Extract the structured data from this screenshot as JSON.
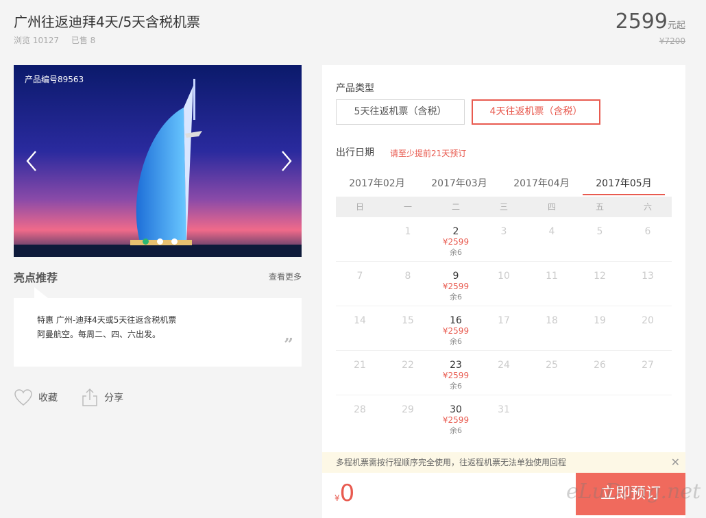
{
  "product": {
    "title": "广州往返迪拜4天/5天含税机票",
    "views": "浏览 10127",
    "sold": "已售 8",
    "price": "2599",
    "price_unit": "元起",
    "orig_price": "¥7200",
    "code": "产品编号89563"
  },
  "highlights": {
    "heading": "亮点推荐",
    "more": "查看更多",
    "line1": "特惠 广州-迪拜4天或5天往返含税机票",
    "line2": "阿曼航空。每周二、四、六出发。",
    "quote": "”"
  },
  "actions": {
    "fav": "收藏",
    "share": "分享"
  },
  "booking": {
    "type_label": "产品类型",
    "types": [
      "5天往返机票（含税）",
      "4天往返机票（含税）"
    ],
    "date_label": "出行日期",
    "hint": "请至少提前21天预订",
    "months": [
      "2017年02月",
      "2017年03月",
      "2017年04月",
      "2017年05月"
    ],
    "weekdays": [
      "日",
      "一",
      "二",
      "三",
      "四",
      "五",
      "六"
    ],
    "weeks": [
      [
        {
          "d": ""
        },
        {
          "d": "1"
        },
        {
          "d": "2",
          "p": "¥2599",
          "r": "余6"
        },
        {
          "d": "3"
        },
        {
          "d": "4"
        },
        {
          "d": "5"
        },
        {
          "d": "6"
        }
      ],
      [
        {
          "d": "7"
        },
        {
          "d": "8"
        },
        {
          "d": "9",
          "p": "¥2599",
          "r": "余6"
        },
        {
          "d": "10"
        },
        {
          "d": "11"
        },
        {
          "d": "12"
        },
        {
          "d": "13"
        }
      ],
      [
        {
          "d": "14"
        },
        {
          "d": "15"
        },
        {
          "d": "16",
          "p": "¥2599",
          "r": "余6"
        },
        {
          "d": "17"
        },
        {
          "d": "18"
        },
        {
          "d": "19"
        },
        {
          "d": "20"
        }
      ],
      [
        {
          "d": "21"
        },
        {
          "d": "22"
        },
        {
          "d": "23",
          "p": "¥2599",
          "r": "余6"
        },
        {
          "d": "24"
        },
        {
          "d": "25"
        },
        {
          "d": "26"
        },
        {
          "d": "27"
        }
      ],
      [
        {
          "d": "28"
        },
        {
          "d": "29"
        },
        {
          "d": "30",
          "p": "¥2599",
          "r": "余6"
        },
        {
          "d": "31"
        },
        {
          "d": ""
        },
        {
          "d": ""
        },
        {
          "d": ""
        }
      ]
    ],
    "notice": "多程机票需按行程顺序完全使用，往返程机票无法单独使用回程",
    "close": "✕",
    "currency": "¥",
    "total": "0",
    "book_label": "立即预订"
  },
  "watermark": "eLuDang.net",
  "colors": {
    "accent": "#e85a4f",
    "book": "#f06a5d",
    "dot_active": "#2bb673"
  }
}
